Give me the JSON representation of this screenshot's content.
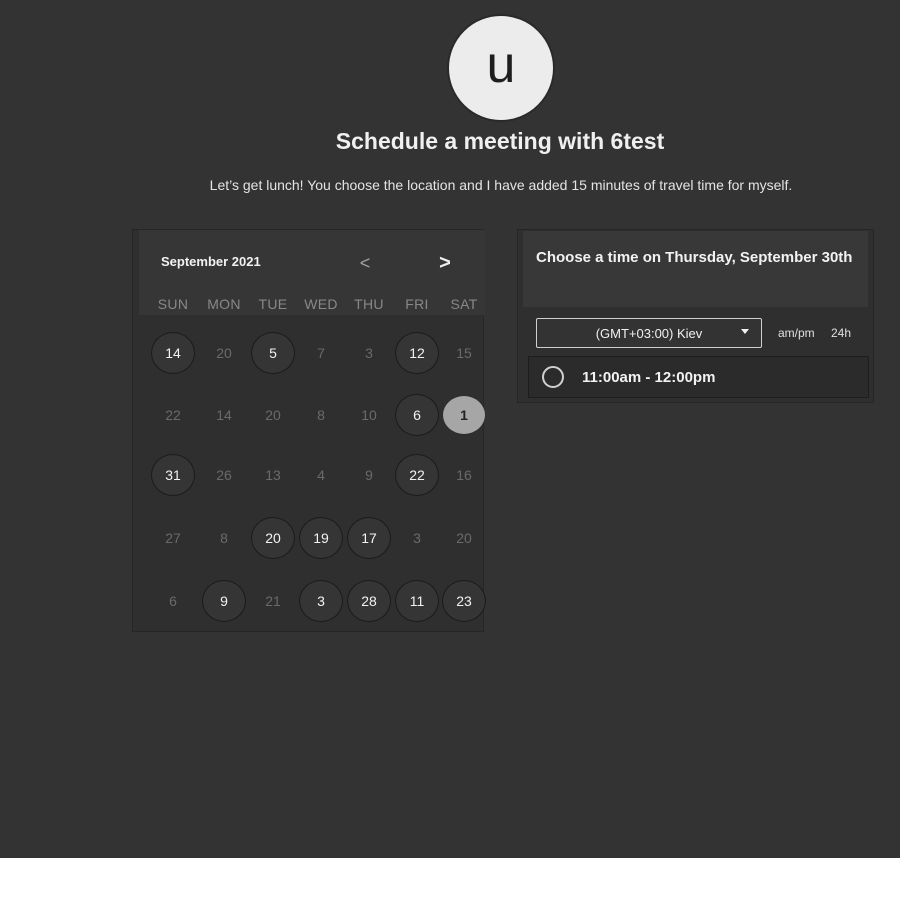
{
  "host": {
    "avatar_letter": "u"
  },
  "page": {
    "title": "Schedule a meeting with 6test",
    "description": "Let’s get lunch! You choose the location and I have added 15 minutes of travel time for myself."
  },
  "calendar": {
    "month_label": "September 2021",
    "prev_label": "<",
    "next_label": ">",
    "weekdays": [
      "SUN",
      "MON",
      "TUE",
      "WED",
      "THU",
      "FRI",
      "SAT"
    ],
    "weeks": [
      [
        {
          "d": "14",
          "s": "avail"
        },
        {
          "d": "20",
          "s": "dim"
        },
        {
          "d": "5",
          "s": "avail"
        },
        {
          "d": "7",
          "s": "dim"
        },
        {
          "d": "3",
          "s": "dim"
        },
        {
          "d": "12",
          "s": "avail"
        },
        {
          "d": "15",
          "s": "dim"
        }
      ],
      [
        {
          "d": "22",
          "s": "dim"
        },
        {
          "d": "14",
          "s": "dim"
        },
        {
          "d": "20",
          "s": "dim"
        },
        {
          "d": "8",
          "s": "dim"
        },
        {
          "d": "10",
          "s": "dim"
        },
        {
          "d": "6",
          "s": "avail"
        },
        {
          "d": "1",
          "s": "selected"
        }
      ],
      [
        {
          "d": "31",
          "s": "avail"
        },
        {
          "d": "26",
          "s": "dim"
        },
        {
          "d": "13",
          "s": "dim"
        },
        {
          "d": "4",
          "s": "dim"
        },
        {
          "d": "9",
          "s": "dim"
        },
        {
          "d": "22",
          "s": "avail"
        },
        {
          "d": "16",
          "s": "dim"
        }
      ],
      [
        {
          "d": "27",
          "s": "dim"
        },
        {
          "d": "8",
          "s": "dim"
        },
        {
          "d": "20",
          "s": "avail"
        },
        {
          "d": "19",
          "s": "avail"
        },
        {
          "d": "17",
          "s": "avail"
        },
        {
          "d": "3",
          "s": "dim"
        },
        {
          "d": "20",
          "s": "dim"
        }
      ],
      [
        {
          "d": "6",
          "s": "dim"
        },
        {
          "d": "9",
          "s": "avail"
        },
        {
          "d": "21",
          "s": "dim"
        },
        {
          "d": "3",
          "s": "avail"
        },
        {
          "d": "28",
          "s": "avail"
        },
        {
          "d": "11",
          "s": "avail"
        },
        {
          "d": "23",
          "s": "avail"
        }
      ]
    ]
  },
  "times": {
    "heading": "Choose a time on Thursday, September 30th",
    "timezone": "(GMT+03:00) Kiev",
    "format_ampm": "am/pm",
    "format_24": "24h",
    "slots": [
      {
        "label": "11:00am - 12:00pm"
      }
    ]
  }
}
